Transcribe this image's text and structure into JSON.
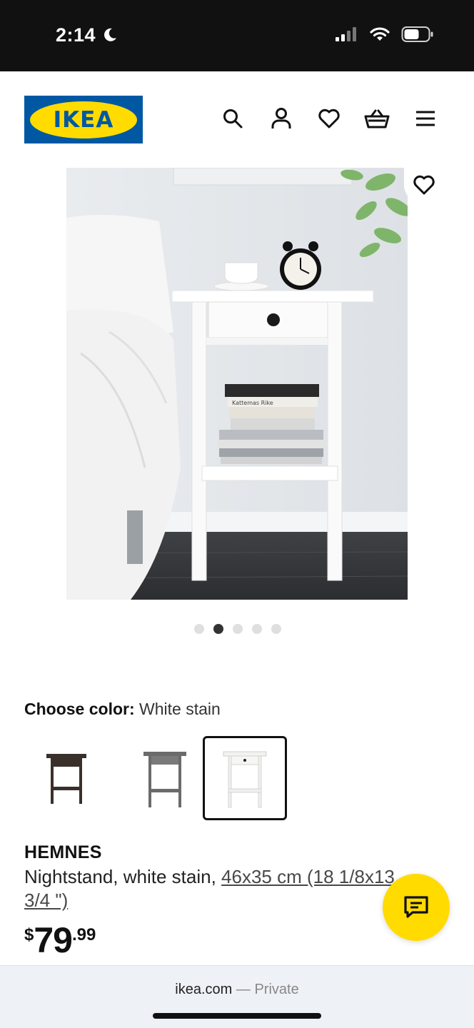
{
  "status_bar": {
    "time": "2:14",
    "moon_icon": "moon-icon",
    "signal_icon": "cellular-signal-icon",
    "wifi_icon": "wifi-icon",
    "battery_icon": "battery-icon"
  },
  "header": {
    "logo_text": "IKEA",
    "icons": [
      "search-icon",
      "account-icon",
      "heart-icon",
      "shopping-bag-icon",
      "menu-icon"
    ]
  },
  "gallery": {
    "image_alt": "White nightstand beside a bed with alarm clock, cup and books",
    "book_spine_text": "Kattemas Rike",
    "dots_total": 5,
    "active_dot": 2
  },
  "color_picker": {
    "label": "Choose color:",
    "selected_value": "White stain",
    "swatches": [
      {
        "name": "black-brown",
        "color": "#3a302b"
      },
      {
        "name": "gray",
        "color": "#6b6b6b"
      },
      {
        "name": "white stain",
        "color": "#f2f2f0",
        "selected": true
      }
    ]
  },
  "product": {
    "name": "HEMNES",
    "description": "Nightstand, white stain, ",
    "measurement": "46x35 cm (18 1/8x13 3/4 \")",
    "price": {
      "currency": "$",
      "integer": "79",
      "decimal": ".99"
    }
  },
  "browser": {
    "domain": "ikea.com",
    "separator": "—",
    "mode": "Private"
  },
  "colors": {
    "ikea_blue": "#0058a3",
    "ikea_yellow": "#ffdb00"
  }
}
